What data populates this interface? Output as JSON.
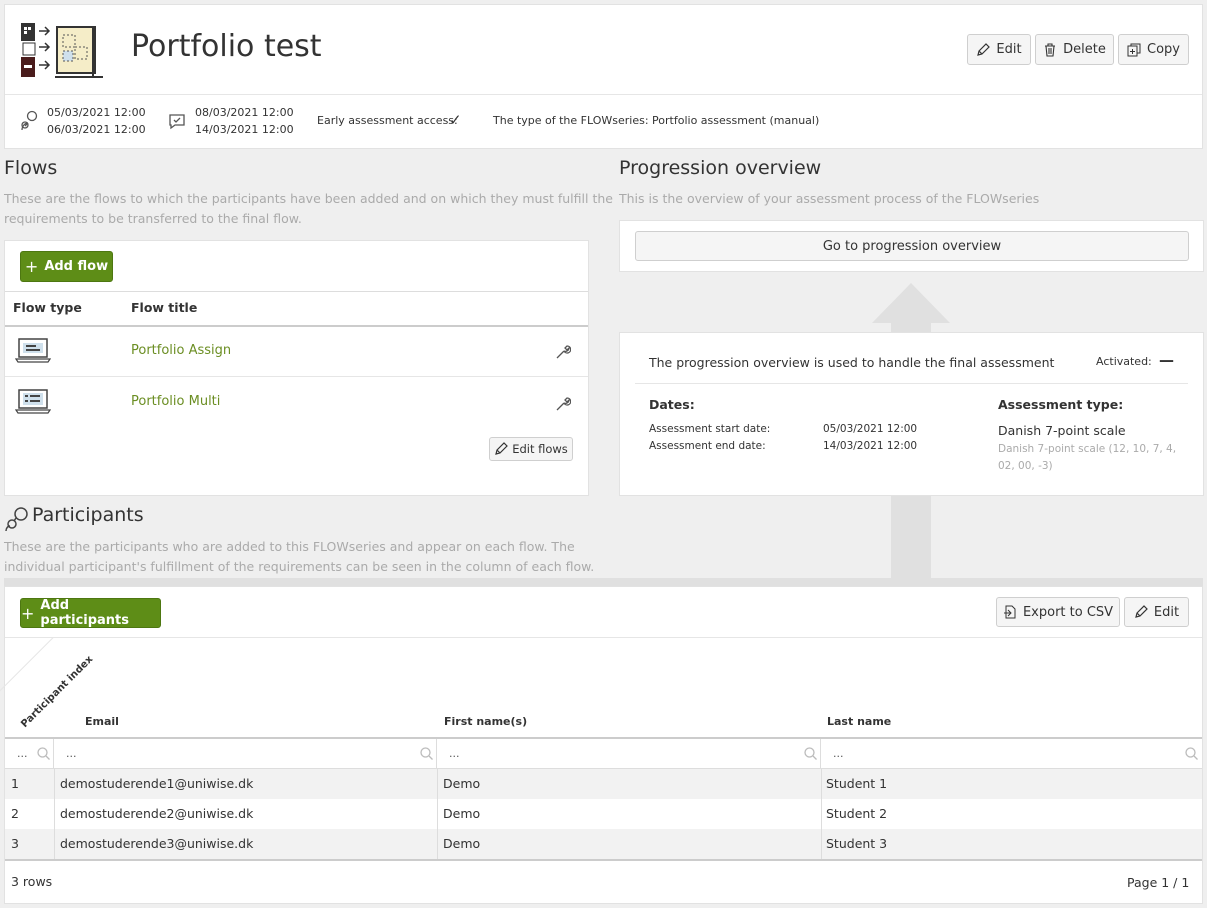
{
  "header": {
    "title": "Portfolio test",
    "edit_label": "Edit",
    "delete_label": "Delete",
    "copy_label": "Copy",
    "participant_dates": [
      "05/03/2021 12:00",
      "06/03/2021 12:00"
    ],
    "feedback_dates": [
      "08/03/2021 12:00",
      "14/03/2021 12:00"
    ],
    "early_access_label": "Early assessment access:",
    "early_access_mark": "✓",
    "type_label": "The type of the FLOWseries: Portfolio assessment (manual)"
  },
  "flows": {
    "title": "Flows",
    "subtitle_line1": "These are the flows to which the participants have been added and on which they must fulfill the",
    "subtitle_line2": "requirements to be transferred to the final flow.",
    "add_label": "Add flow",
    "col_type": "Flow type",
    "col_title": "Flow title",
    "items": [
      {
        "title": "Portfolio Assign",
        "icon": "laptop-icon"
      },
      {
        "title": "Portfolio Multi",
        "icon": "laptop-list-icon"
      }
    ],
    "edit_flows_label": "Edit flows"
  },
  "progression": {
    "title": "Progression overview",
    "subtitle": "This is the overview of your assessment process of the FLOWseries",
    "goto_label": "Go to progression overview",
    "info_text": "The progression overview is used to handle the final assessment",
    "activated_label": "Activated:",
    "activated_mark": "—",
    "dates_title": "Dates:",
    "start_label": "Assessment start date:",
    "start_value": "05/03/2021 12:00",
    "end_label": "Assessment end date:",
    "end_value": "14/03/2021 12:00",
    "atype_title": "Assessment type:",
    "atype_value": "Danish 7-point scale",
    "atype_detail_line1": "Danish 7-point scale (12, 10, 7, 4,",
    "atype_detail_line2": "02, 00, -3)"
  },
  "participants": {
    "title": "Participants",
    "subtitle_line1": "These are the participants who are added to this FLOWseries and appear on each flow. The",
    "subtitle_line2": "individual participant's fulfillment of the requirements can be seen in the column of each flow.",
    "add_label": "Add participants",
    "export_label": "Export to CSV",
    "edit_label": "Edit",
    "col_index": "Participant index",
    "col_email": "Email",
    "col_first": "First name(s)",
    "col_last": "Last name",
    "filter_placeholder": "...",
    "rows": [
      {
        "index": "1",
        "email": "demostuderende1@uniwise.dk",
        "first": "Demo",
        "last": "Student 1"
      },
      {
        "index": "2",
        "email": "demostuderende2@uniwise.dk",
        "first": "Demo",
        "last": "Student 2"
      },
      {
        "index": "3",
        "email": "demostuderende3@uniwise.dk",
        "first": "Demo",
        "last": "Student 3"
      }
    ],
    "row_count": "3 rows",
    "page_info": "Page 1 / 1"
  }
}
